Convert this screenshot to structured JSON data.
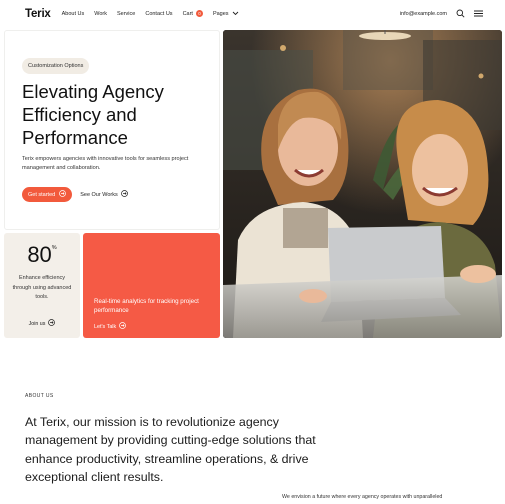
{
  "nav": {
    "logo": "Terix",
    "links": [
      "About Us",
      "Work",
      "Service",
      "Contact Us"
    ],
    "cart_label": "Cart",
    "cart_count": "0",
    "pages_label": "Pages",
    "email": "info@example.com"
  },
  "hero": {
    "badge": "Customization Options",
    "title": "Elevating Agency Efficiency and Performance",
    "description": "Terix empowers agencies with innovative tools for seamless project management and collaboration.",
    "primary_button": "Get started",
    "secondary_link": "See Our Works"
  },
  "stat": {
    "number": "80",
    "suffix": "%",
    "text": "Enhance efficiency through using advanced tools.",
    "link": "Join us"
  },
  "promo": {
    "text": "Real-time analytics for tracking project performance",
    "link": "Let's Talk"
  },
  "about": {
    "label": "ABOUT US",
    "mission": "At Terix, our mission is to revolutionize agency management by providing cutting-edge solutions that enhance productivity, streamline operations, & drive exceptional client results.",
    "envision": "We envision a future where every agency operates with unparalleled"
  },
  "colors": {
    "accent": "#f25a3c",
    "promo_bg": "#f55a45",
    "stat_bg": "#f3efe9",
    "badge_bg": "#f1ece4"
  },
  "icons": {
    "search": "search-icon",
    "menu": "hamburger-menu-icon",
    "arrow": "arrow-circle-icon",
    "chevron": "chevron-down-icon"
  }
}
